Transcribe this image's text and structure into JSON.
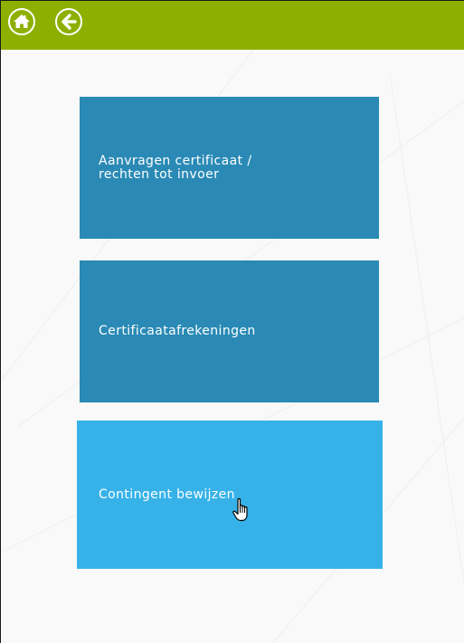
{
  "header": {
    "home_icon": "home-icon",
    "back_icon": "arrow-left-icon",
    "bar_color": "#8db000"
  },
  "tiles": [
    {
      "label": "Aanvragen certificaat /\nrechten tot invoer",
      "color": "#2a8ab5",
      "state": "default"
    },
    {
      "label": "Certificaatafrekeningen",
      "color": "#2a8ab5",
      "state": "default"
    },
    {
      "label": "Contingent bewijzen",
      "color": "#36b2e8",
      "state": "hover"
    }
  ],
  "cursor_icon": "hand-pointer-icon"
}
